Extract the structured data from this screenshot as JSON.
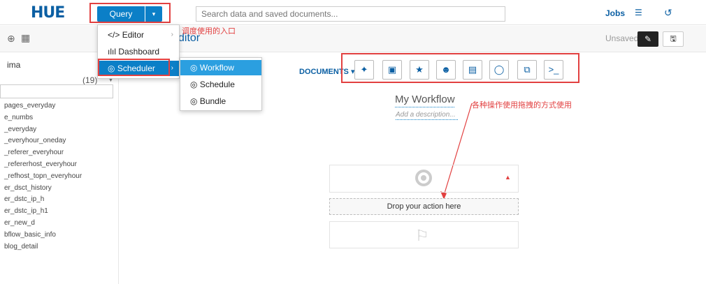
{
  "app": {
    "logo": "HUE"
  },
  "topbar": {
    "query_label": "Query",
    "query_caret": "▾",
    "search_placeholder": "Search data and saved documents...",
    "jobs_label": "Jobs"
  },
  "menu": {
    "items": [
      {
        "icon": "</>",
        "label": "Editor"
      },
      {
        "icon": "ılıl",
        "label": "Dashboard"
      },
      {
        "icon": "◎",
        "label": "Scheduler"
      }
    ],
    "chevron": "›"
  },
  "submenu": {
    "items": [
      {
        "icon": "◎",
        "label": "Workflow"
      },
      {
        "icon": "◎",
        "label": "Schedule"
      },
      {
        "icon": "◎",
        "label": "Bundle"
      }
    ]
  },
  "subbar": {
    "editor_title": "ditor",
    "annotation": "调度使用的入口",
    "unsaved_label": "Unsaved"
  },
  "leftpanel": {
    "db_name": "ima",
    "table_count": "(19)",
    "tables": [
      "pages_everyday",
      "e_numbs",
      "_everyday",
      "_everyhour_oneday",
      "_referer_everyhour",
      "_refererhost_everyhour",
      "_refhost_topn_everyhour",
      "er_dsct_history",
      "er_dstc_ip_h",
      "er_dstc_ip_h1",
      "er_new_d",
      "bflow_basic_info",
      "blog_detail"
    ]
  },
  "workflow": {
    "documents_label": "DOCUMENTS",
    "title": "My Workflow",
    "description_placeholder": "Add a description...",
    "annotation": "各种操作使用拖拽的方式使用",
    "drop_label": "Drop your action here",
    "tools": [
      "hive-icon",
      "code-icon",
      "spark-icon",
      "pig-icon",
      "java-icon",
      "subworkflow-icon",
      "copy-icon",
      "shell-icon"
    ]
  },
  "colors": {
    "accent": "#0b7fc7",
    "annotation": "#e24040",
    "brand": "#0b5fa3"
  }
}
